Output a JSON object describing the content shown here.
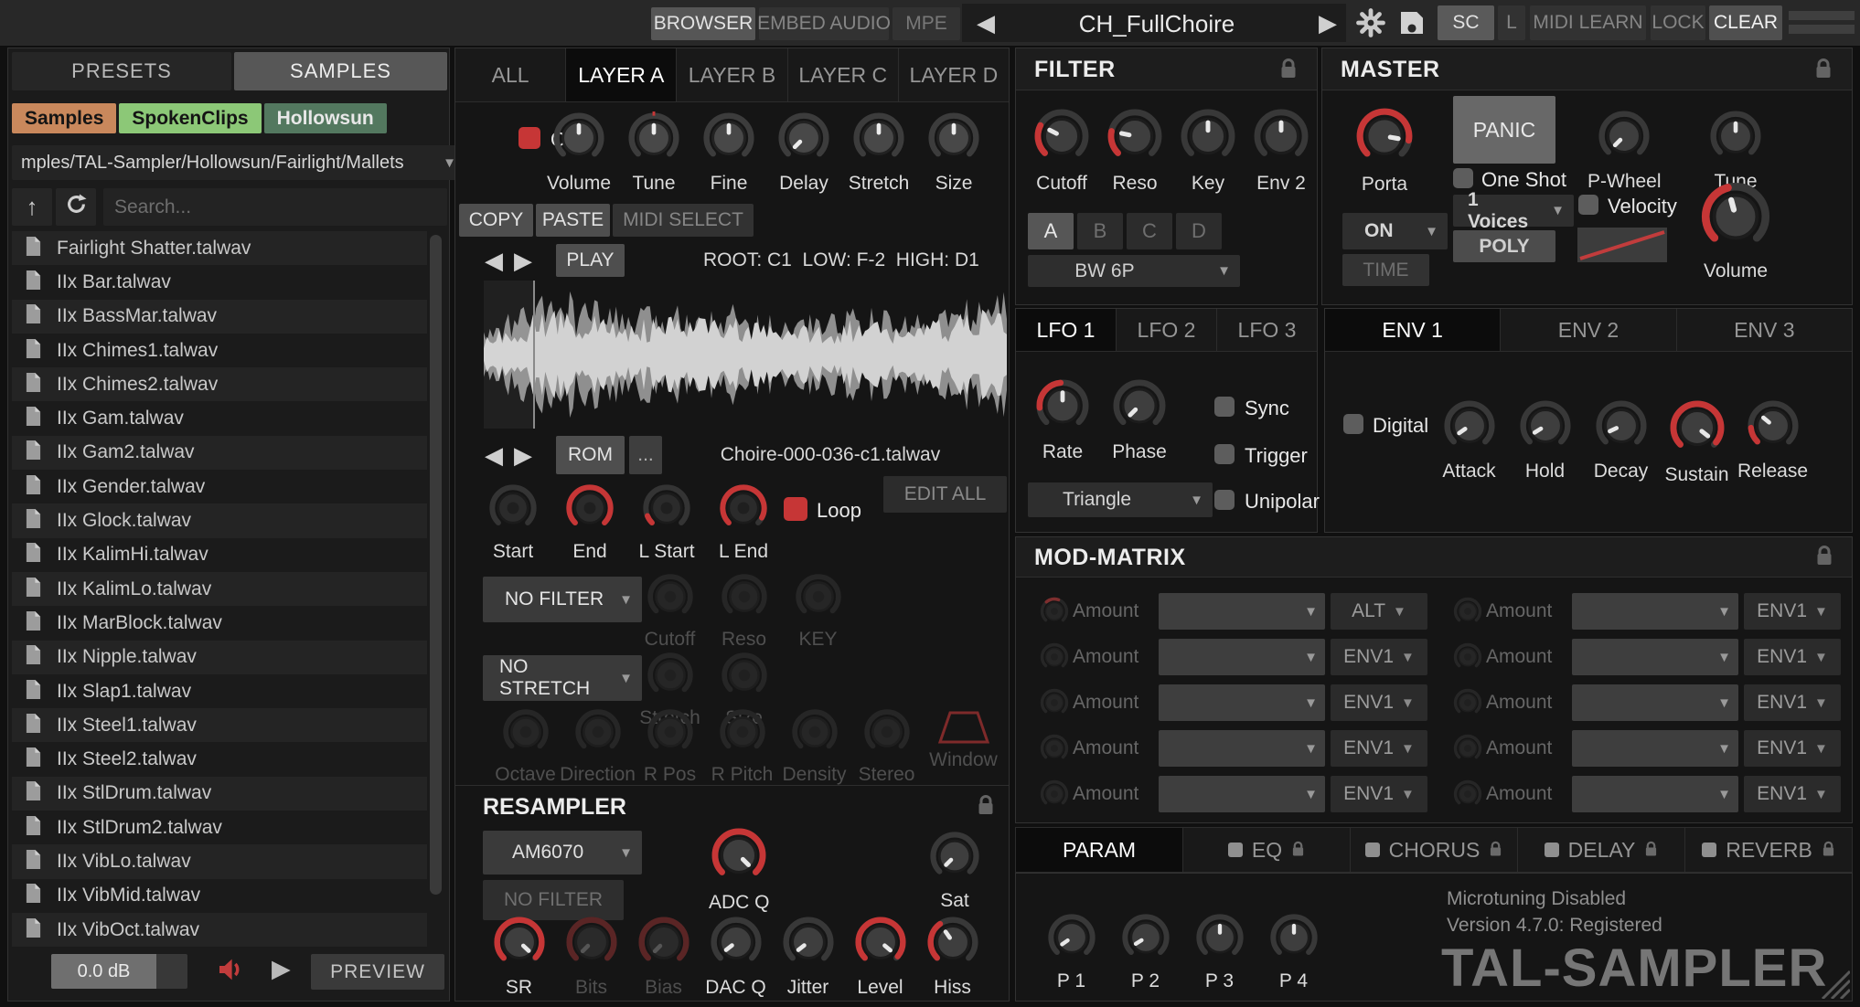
{
  "colors": {
    "accent": "#c63636",
    "dim_red": "#5a2525",
    "tag_samples": "#c9885c",
    "tag_spoken": "#8cc877",
    "tag_hollowsun": "#53785f"
  },
  "topbar": {
    "browser": "BROWSER",
    "embed_audio": "EMBED AUDIO",
    "mpe": "MPE",
    "preset_name": "CH_FullChoire",
    "sc": "SC",
    "l": "L",
    "midi_learn": "MIDI LEARN",
    "lock": "LOCK",
    "clear": "CLEAR"
  },
  "browser": {
    "tab_presets": "PRESETS",
    "tab_samples": "SAMPLES",
    "tags": [
      {
        "label": "Samples",
        "color": "#c9885c",
        "text": "#141414"
      },
      {
        "label": "SpokenClips",
        "color": "#8cc877",
        "text": "#141414"
      },
      {
        "label": "Hollowsun",
        "color": "#53785f",
        "text": "#e8e8e8"
      }
    ],
    "path": "mples/TAL-Sampler/Hollowsun/Fairlight/Mallets",
    "search_placeholder": "Search...",
    "files": [
      "Fairlight Shatter.talwav",
      "IIx Bar.talwav",
      "IIx BassMar.talwav",
      "IIx Chimes1.talwav",
      "IIx Chimes2.talwav",
      "IIx Gam.talwav",
      "IIx Gam2.talwav",
      "IIx Gender.talwav",
      "IIx Glock.talwav",
      "IIx KalimHi.talwav",
      "IIx KalimLo.talwav",
      "IIx MarBlock.talwav",
      "IIx Nipple.talwav",
      "IIx Slap1.talwav",
      "IIx Steel1.talwav",
      "IIx Steel2.talwav",
      "IIx StlDrum.talwav",
      "IIx StlDrum2.talwav",
      "IIx VibLo.talwav",
      "IIx VibMid.talwav",
      "IIx VibOct.talwav"
    ],
    "volume_db": "0.0 dB",
    "preview": "PREVIEW"
  },
  "layer": {
    "tabs": [
      {
        "label": "ALL"
      },
      {
        "label": "LAYER A",
        "active": true
      },
      {
        "label": "LAYER B"
      },
      {
        "label": "LAYER C"
      },
      {
        "label": "LAYER D"
      }
    ],
    "on_label": "On",
    "knobs": [
      {
        "label": "Volume",
        "variant": "light",
        "angle": 0,
        "size": 58
      },
      {
        "label": "Tune",
        "variant": "light",
        "angle": 0,
        "size": 58,
        "tick": true
      },
      {
        "label": "Fine",
        "variant": "light",
        "angle": 0,
        "size": 58
      },
      {
        "label": "Delay",
        "variant": "light",
        "angle": -135,
        "size": 58
      },
      {
        "label": "Stretch",
        "variant": "light",
        "angle": 0,
        "size": 58
      },
      {
        "label": "Size",
        "variant": "light",
        "angle": 0,
        "size": 58
      }
    ],
    "copy": "COPY",
    "paste": "PASTE",
    "midi_select": "MIDI SELECT",
    "play": "PLAY",
    "root_info": "ROOT: C1  LOW: F-2  HIGH: D1",
    "rom": "ROM",
    "more": "...",
    "sample_name": "Choire-000-036-c1.talwav",
    "edit_all": "EDIT ALL",
    "loop": "Loop",
    "trim_knobs": [
      {
        "label": "Start",
        "variant": "dark",
        "size": 54
      },
      {
        "label": "End",
        "variant": "dark",
        "size": 54,
        "arc_to": 135
      },
      {
        "label": "L Start",
        "variant": "dark",
        "size": 54,
        "arc_to": -112
      },
      {
        "label": "L End",
        "variant": "dark",
        "size": 54,
        "arc_to": 118
      }
    ],
    "filter_select": "NO FILTER",
    "filter_knobs": [
      {
        "label": "Cutoff",
        "variant": "dim",
        "size": 52
      },
      {
        "label": "Reso",
        "variant": "dim",
        "size": 52
      },
      {
        "label": "KEY",
        "variant": "dim",
        "size": 52
      }
    ],
    "stretch_select": "NO STRETCH",
    "stretch_knobs": [
      {
        "label": "Stretch",
        "variant": "dim",
        "size": 52
      },
      {
        "label": "Size",
        "variant": "dim",
        "size": 52
      }
    ],
    "granular_knobs": [
      {
        "label": "Octave",
        "variant": "dim",
        "size": 52
      },
      {
        "label": "Direction",
        "variant": "dim",
        "size": 52
      },
      {
        "label": "R Pos",
        "variant": "dim",
        "size": 52
      },
      {
        "label": "R Pitch",
        "variant": "dim",
        "size": 52
      },
      {
        "label": "Density",
        "variant": "dim",
        "size": 52
      },
      {
        "label": "Stereo",
        "variant": "dim",
        "size": 52
      }
    ],
    "window_label": "Window"
  },
  "resampler": {
    "title": "RESAMPLER",
    "model": "AM6070",
    "filter": "NO FILTER",
    "adc_q": {
      "label": "ADC Q",
      "variant": "dark2",
      "angle": 135,
      "arc_to": 135,
      "size": 62
    },
    "sat": {
      "label": "Sat",
      "variant": "dark2",
      "angle": -135,
      "size": 56
    },
    "knobs": [
      {
        "label": "SR",
        "variant": "dark2",
        "angle": 133,
        "arc_to": 133,
        "size": 58
      },
      {
        "label": "Bits",
        "variant": "dimred",
        "angle": -135,
        "arc_to": 135,
        "arc_color": "#5a2525",
        "size": 58
      },
      {
        "label": "Bias",
        "variant": "dimred",
        "angle": -135,
        "arc_to": 135,
        "arc_color": "#5a2525",
        "size": 58
      },
      {
        "label": "DAC Q",
        "variant": "dark2",
        "angle": -128,
        "size": 58
      },
      {
        "label": "Jitter",
        "variant": "dark2",
        "angle": -128,
        "size": 58
      },
      {
        "label": "Level",
        "variant": "dark2",
        "angle": 130,
        "arc_to": 130,
        "size": 58
      },
      {
        "label": "Hiss",
        "variant": "dark2",
        "angle": -35,
        "arc_to": -35,
        "size": 58
      }
    ]
  },
  "filter": {
    "title": "FILTER",
    "knobs": [
      {
        "label": "Cutoff",
        "variant": "dark2",
        "angle": -63,
        "arc_to": -63,
        "size": 62
      },
      {
        "label": "Reso",
        "variant": "dark2",
        "angle": -78,
        "arc_to": -78,
        "size": 62
      },
      {
        "label": "Key",
        "variant": "dark2",
        "angle": 0,
        "size": 62
      },
      {
        "label": "Env 2",
        "variant": "dark2",
        "angle": 0,
        "size": 62
      }
    ],
    "layers": [
      {
        "label": "A",
        "active": true
      },
      {
        "label": "B"
      },
      {
        "label": "C"
      },
      {
        "label": "D"
      }
    ],
    "type": "BW 6P"
  },
  "master": {
    "title": "MASTER",
    "porta": {
      "label": "Porta",
      "variant": "dark2",
      "angle": 100,
      "arc_to": 100,
      "size": 64
    },
    "mode": "ON",
    "time": "TIME",
    "panic": "PANIC",
    "one_shot": "One Shot",
    "voices": "1 Voices",
    "poly": "POLY",
    "p_wheel": {
      "label": "P-Wheel",
      "variant": "dark2",
      "angle": -135,
      "size": 58
    },
    "velocity": "Velocity",
    "tune": {
      "label": "Tune",
      "variant": "dark2",
      "angle": 0,
      "size": 58
    },
    "volume": {
      "label": "Volume",
      "variant": "dark2",
      "angle": -15,
      "arc_to": -15,
      "size": 78
    }
  },
  "lfo": {
    "tabs": [
      {
        "label": "LFO 1",
        "active": true
      },
      {
        "label": "LFO 2"
      },
      {
        "label": "LFO 3"
      }
    ],
    "rate": {
      "label": "Rate",
      "variant": "dark2",
      "angle": 0,
      "arc_from": -95,
      "arc_to": -5,
      "size": 60
    },
    "phase": {
      "label": "Phase",
      "variant": "dark2",
      "angle": -135,
      "size": 60
    },
    "sync": "Sync",
    "trigger": "Trigger",
    "unipolar": "Unipolar",
    "waveform": "Triangle"
  },
  "env": {
    "tabs": [
      {
        "label": "ENV 1",
        "active": true
      },
      {
        "label": "ENV 2"
      },
      {
        "label": "ENV 3"
      }
    ],
    "digital": "Digital",
    "knobs": [
      {
        "label": "Attack",
        "variant": "dark2",
        "angle": -125,
        "size": 58
      },
      {
        "label": "Hold",
        "variant": "dark2",
        "angle": -122,
        "size": 58
      },
      {
        "label": "Decay",
        "variant": "dark2",
        "angle": -115,
        "size": 58
      },
      {
        "label": "Sustain",
        "variant": "dark2",
        "angle": 128,
        "arc_to": 128,
        "size": 62
      },
      {
        "label": "Release",
        "variant": "dark2",
        "angle": -50,
        "arc_to": -95,
        "size": 58
      }
    ]
  },
  "mod_matrix": {
    "title": "MOD-MATRIX",
    "rows_left": [
      {
        "amount_label": "Amount",
        "target": "ALT",
        "red": true
      },
      {
        "amount_label": "Amount",
        "target": "ENV1"
      },
      {
        "amount_label": "Amount",
        "target": "ENV1"
      },
      {
        "amount_label": "Amount",
        "target": "ENV1"
      },
      {
        "amount_label": "Amount",
        "target": "ENV1"
      }
    ],
    "rows_right": [
      {
        "amount_label": "Amount",
        "target": "ENV1"
      },
      {
        "amount_label": "Amount",
        "target": "ENV1"
      },
      {
        "amount_label": "Amount",
        "target": "ENV1"
      },
      {
        "amount_label": "Amount",
        "target": "ENV1"
      },
      {
        "amount_label": "Amount",
        "target": "ENV1"
      }
    ]
  },
  "fx": {
    "tabs": [
      {
        "label": "PARAM",
        "active": true
      },
      {
        "label": "EQ",
        "toggle": true,
        "lock": true
      },
      {
        "label": "CHORUS",
        "toggle": true,
        "lock": true
      },
      {
        "label": "DELAY",
        "toggle": true,
        "lock": true
      },
      {
        "label": "REVERB",
        "toggle": true,
        "lock": true
      }
    ]
  },
  "param": {
    "knobs": [
      {
        "label": "P 1",
        "variant": "dark2",
        "angle": -125,
        "size": 54
      },
      {
        "label": "P 2",
        "variant": "dark2",
        "angle": -122,
        "size": 54
      },
      {
        "label": "P 3",
        "variant": "dark2",
        "angle": 0,
        "size": 54
      },
      {
        "label": "P 4",
        "variant": "dark2",
        "angle": 0,
        "size": 54
      }
    ],
    "microtuning": "Microtuning Disabled",
    "version": "Version 4.7.0: Registered",
    "logo": "TAL-SAMPLER"
  }
}
